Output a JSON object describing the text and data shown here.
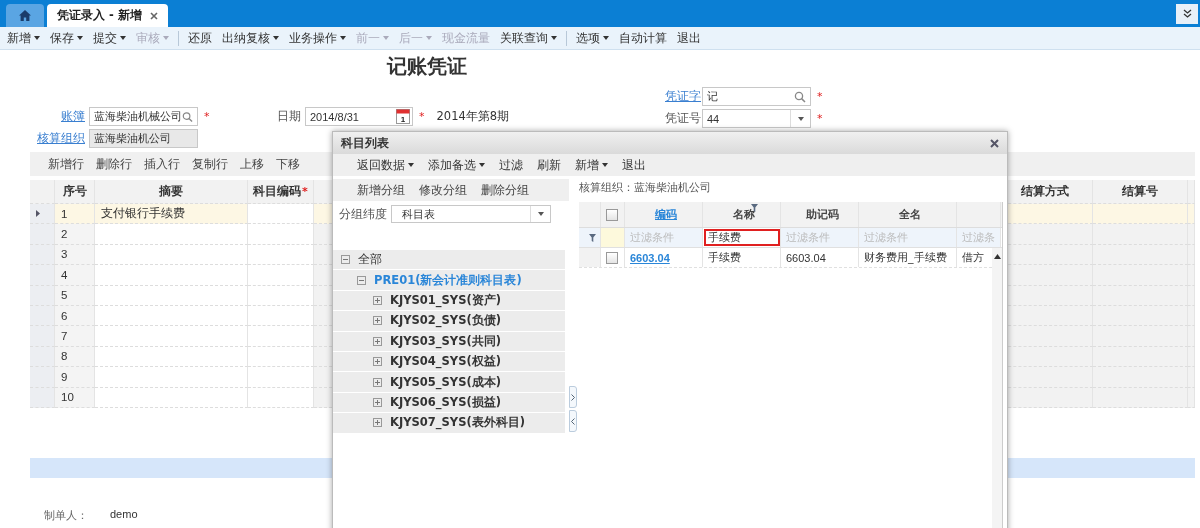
{
  "tabs": [
    {
      "kind": "home",
      "selected": false
    },
    {
      "kind": "page",
      "label": "凭证录入 - 新增",
      "selected": true
    }
  ],
  "toolbar": [
    [
      {
        "label": "新增",
        "dropdown": true,
        "disabled": false
      },
      {
        "label": "保存",
        "dropdown": true,
        "disabled": false
      },
      {
        "label": "提交",
        "dropdown": true,
        "disabled": false
      },
      {
        "label": "审核",
        "dropdown": true,
        "disabled": true
      }
    ],
    [
      {
        "label": "还原",
        "dropdown": false,
        "disabled": false
      },
      {
        "label": "出纳复核",
        "dropdown": true,
        "disabled": false
      },
      {
        "label": "业务操作",
        "dropdown": true,
        "disabled": false
      },
      {
        "label": "前一",
        "dropdown": true,
        "disabled": true
      },
      {
        "label": "后一",
        "dropdown": true,
        "disabled": true
      },
      {
        "label": "现金流量",
        "dropdown": false,
        "disabled": true
      },
      {
        "label": "关联查询",
        "dropdown": true,
        "disabled": false
      }
    ],
    [
      {
        "label": "选项",
        "dropdown": true,
        "disabled": false
      },
      {
        "label": "自动计算",
        "dropdown": false,
        "disabled": false
      },
      {
        "label": "退出",
        "dropdown": false,
        "disabled": false
      }
    ]
  ],
  "title": "记账凭证",
  "form": {
    "account_book": {
      "label": "账簿",
      "value": "蓝海柴油机械公司",
      "required": "*"
    },
    "org": {
      "label": "核算组织",
      "value": "蓝海柴油机公司"
    },
    "date": {
      "label": "日期",
      "value": "2014/8/31",
      "required": "*",
      "calendar_day": "1"
    },
    "period": "2014年第8期",
    "voucher_word": {
      "label": "凭证字",
      "value": "记",
      "required": "*"
    },
    "voucher_no": {
      "label": "凭证号",
      "value": "44",
      "required": "*"
    }
  },
  "grid_toolbar": [
    "新增行",
    "删除行",
    "插入行",
    "复制行",
    "上移",
    "下移"
  ],
  "grid": {
    "columns": [
      {
        "label": "序号"
      },
      {
        "label": "摘要"
      },
      {
        "label": "科目编码",
        "required": "*"
      }
    ],
    "right_columns": [
      "结算方式",
      "结算号"
    ],
    "rows": [
      {
        "number": "1",
        "summary": "支付银行手续费",
        "selected": true
      },
      {
        "number": "2",
        "summary": "",
        "selected": false
      },
      {
        "number": "3",
        "summary": "",
        "selected": false
      },
      {
        "number": "4",
        "summary": "",
        "selected": false
      },
      {
        "number": "5",
        "summary": "",
        "selected": false
      },
      {
        "number": "6",
        "summary": "",
        "selected": false
      },
      {
        "number": "7",
        "summary": "",
        "selected": false
      },
      {
        "number": "8",
        "summary": "",
        "selected": false
      },
      {
        "number": "9",
        "summary": "",
        "selected": false
      },
      {
        "number": "10",
        "summary": "",
        "selected": false
      }
    ]
  },
  "preparer": {
    "label": "制单人：",
    "value": "demo"
  },
  "dialog": {
    "title": "科目列表",
    "toolbar": [
      {
        "label": "返回数据",
        "dropdown": true
      },
      {
        "label": "添加备选",
        "dropdown": true
      },
      {
        "label": "过滤",
        "dropdown": false
      },
      {
        "label": "刷新",
        "dropdown": false
      },
      {
        "label": "新增",
        "dropdown": true
      },
      {
        "label": "退出",
        "dropdown": false
      }
    ],
    "group_buttons": [
      "新增分组",
      "修改分组",
      "删除分组"
    ],
    "group_dimension": {
      "label": "分组纬度",
      "value": "科目表"
    },
    "tree": [
      {
        "label": "全部",
        "expanded": true,
        "selected": false,
        "children": [
          {
            "label": "PRE01(新会计准则科目表)",
            "expanded": true,
            "selected": true,
            "children": [
              {
                "label": "KJYS01_SYS(资产)",
                "expanded": false,
                "selected": false
              },
              {
                "label": "KJYS02_SYS(负债)",
                "expanded": false,
                "selected": false
              },
              {
                "label": "KJYS03_SYS(共同)",
                "expanded": false,
                "selected": false
              },
              {
                "label": "KJYS04_SYS(权益)",
                "expanded": false,
                "selected": false
              },
              {
                "label": "KJYS05_SYS(成本)",
                "expanded": false,
                "selected": false
              },
              {
                "label": "KJYS06_SYS(损益)",
                "expanded": false,
                "selected": false
              },
              {
                "label": "KJYS07_SYS(表外科目)",
                "expanded": false,
                "selected": false
              }
            ]
          }
        ]
      }
    ],
    "org_label": "核算组织：",
    "org_value": "蓝海柴油机公司",
    "columns": [
      {
        "label": "编码",
        "link": true,
        "filtered": false
      },
      {
        "label": "名称",
        "link": false,
        "filtered": true
      },
      {
        "label": "助记码",
        "link": false,
        "filtered": false
      },
      {
        "label": "全名",
        "link": false,
        "filtered": false
      }
    ],
    "all_checked": false,
    "filters": [
      {
        "placeholder": "过滤条件",
        "highlighted": false
      },
      {
        "value": "手续费",
        "highlighted": true
      },
      {
        "placeholder": "过滤条件",
        "highlighted": false
      },
      {
        "placeholder": "过滤条件",
        "highlighted": false
      },
      {
        "placeholder": "过滤条",
        "highlighted": false
      }
    ],
    "rows": [
      {
        "checked": false,
        "code": "6603.04",
        "name": "手续费",
        "mnemonic": "6603.04",
        "full_name": "财务费用_手续费",
        "column_5": "借方"
      }
    ]
  }
}
